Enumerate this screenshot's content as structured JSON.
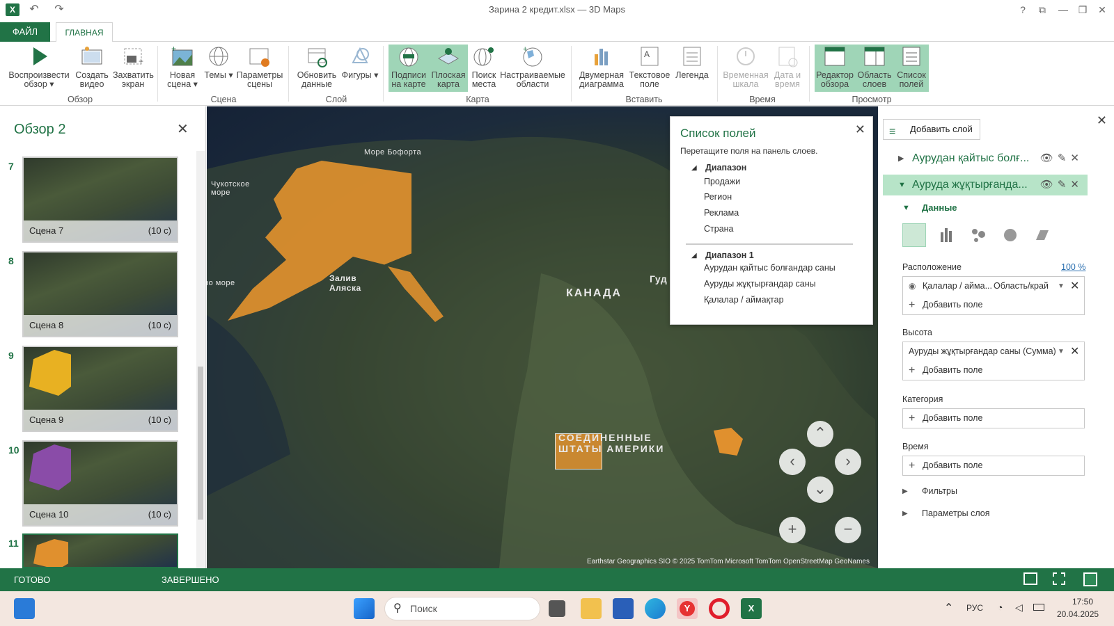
{
  "window": {
    "title": "Зарина 2 кредит.xlsx — 3D Maps",
    "controls": [
      "?",
      "⧉",
      "—",
      "❐",
      "✕"
    ]
  },
  "tabs": {
    "file": "ФАЙЛ",
    "home": "ГЛАВНАЯ"
  },
  "ribbon": {
    "groups": {
      "tour": "Обзор",
      "scene": "Сцена",
      "layer": "Слой",
      "map": "Карта",
      "insert": "Вставить",
      "time": "Время",
      "view": "Просмотр"
    },
    "buttons": {
      "play_tour": "Воспроизвести обзор ▾",
      "create_video": "Создать видео",
      "capture_screen": "Захватить экран",
      "new_scene": "Новая сцена ▾",
      "themes": "Темы ▾",
      "scene_options": "Параметры сцены",
      "refresh_data": "Обновить данные",
      "shapes": "Фигуры ▾",
      "map_labels": "Подписи на карте",
      "flat_map": "Плоская карта",
      "find_location": "Поиск места",
      "custom_regions": "Настраиваемые области",
      "chart_2d": "Двумерная диаграмма",
      "text_box": "Текстовое поле",
      "legend": "Легенда",
      "timeline": "Временная шкала",
      "date_time": "Дата и время",
      "tour_editor": "Редактор обзора",
      "layer_pane": "Область слоев",
      "field_list": "Список полей"
    }
  },
  "tour_panel": {
    "title": "Обзор 2",
    "scenes": [
      {
        "num": "7",
        "label": "Сцена 7",
        "duration": "(10 с)"
      },
      {
        "num": "8",
        "label": "Сцена 8",
        "duration": "(10 с)"
      },
      {
        "num": "9",
        "label": "Сцена 9",
        "duration": "(10 с)"
      },
      {
        "num": "10",
        "label": "Сцена 10",
        "duration": "(10 с)"
      },
      {
        "num": "11",
        "label": "",
        "duration": ""
      }
    ]
  },
  "map": {
    "labels": {
      "beaufort": "Море Бофорта",
      "chukchi": "Чукотское море",
      "bering": "но море",
      "alaska_gulf": "Залив Аляска",
      "canada": "КАНАДА",
      "usa": "СОЕДИНЕННЫЕ ШТАТЫ АМЕРИКИ",
      "hudson": "Гуд"
    },
    "attribution": "Earthstar Geographics SIO © 2025 TomTom Microsoft TomTom OpenStreetMap GeoNames"
  },
  "field_list": {
    "title": "Список полей",
    "subtitle": "Перетащите поля на панель слоев.",
    "groups": [
      {
        "name": "Диапазон",
        "fields": [
          "Продажи",
          "Регион",
          "Реклама",
          "Страна"
        ]
      },
      {
        "name": "Диапазон 1",
        "fields": [
          "Аурудан қайтыс болғандар саны",
          "Ауруды жұқтырғандар саны",
          "Қалалар / аймақтар"
        ]
      }
    ]
  },
  "layer_pane": {
    "add_layer": "Добавить слой",
    "layers": [
      "Аурудан қайтыс болғ...",
      "Ауруда жұқтырғанда..."
    ],
    "data_section": "Данные",
    "location_label": "Расположение",
    "location_percent": "100 %",
    "location_field": "Қалалар / айма...",
    "location_type": "Область/край",
    "height_label": "Высота",
    "height_field": "Ауруды жұқтырғандар саны (Сумма)",
    "category_label": "Категория",
    "time_label": "Время",
    "add_field": "Добавить поле",
    "filters": "Фильтры",
    "layer_options": "Параметры слоя"
  },
  "status_bar": {
    "ready": "ГОТОВО",
    "done": "ЗАВЕРШЕНО"
  },
  "taskbar": {
    "search_placeholder": "Поиск",
    "language": "РУС",
    "time": "17:50",
    "date": "20.04.2025"
  }
}
